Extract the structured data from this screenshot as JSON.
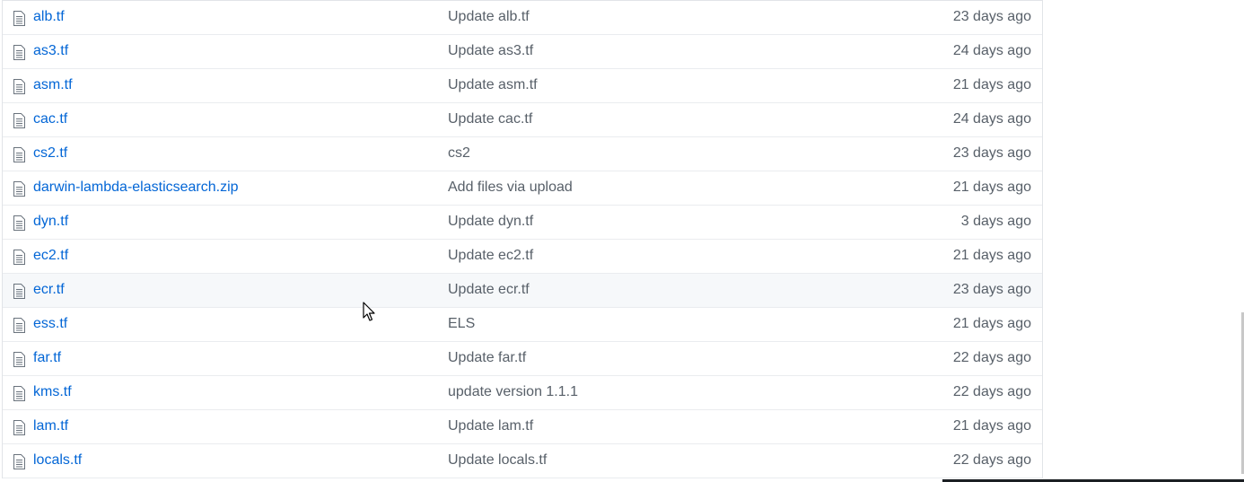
{
  "files": [
    {
      "name": "alb.tf",
      "message": "Update alb.tf",
      "age": "23 days ago"
    },
    {
      "name": "as3.tf",
      "message": "Update as3.tf",
      "age": "24 days ago"
    },
    {
      "name": "asm.tf",
      "message": "Update asm.tf",
      "age": "21 days ago"
    },
    {
      "name": "cac.tf",
      "message": "Update cac.tf",
      "age": "24 days ago"
    },
    {
      "name": "cs2.tf",
      "message": "cs2",
      "age": "23 days ago"
    },
    {
      "name": "darwin-lambda-elasticsearch.zip",
      "message": "Add files via upload",
      "age": "21 days ago"
    },
    {
      "name": "dyn.tf",
      "message": "Update dyn.tf",
      "age": "3 days ago"
    },
    {
      "name": "ec2.tf",
      "message": "Update ec2.tf",
      "age": "21 days ago"
    },
    {
      "name": "ecr.tf",
      "message": "Update ecr.tf",
      "age": "23 days ago"
    },
    {
      "name": "ess.tf",
      "message": "ELS",
      "age": "21 days ago"
    },
    {
      "name": "far.tf",
      "message": "Update far.tf",
      "age": "22 days ago"
    },
    {
      "name": "kms.tf",
      "message": "update version 1.1.1",
      "age": "22 days ago"
    },
    {
      "name": "lam.tf",
      "message": "Update lam.tf",
      "age": "21 days ago"
    },
    {
      "name": "locals.tf",
      "message": "Update locals.tf",
      "age": "22 days ago"
    }
  ],
  "icons": {
    "file": "file-text-icon",
    "cursor": "mouse-pointer-icon"
  },
  "colors": {
    "link": "#0366d6",
    "muted": "#586069",
    "border": "#eaecef",
    "hover_row": "#f6f8fa"
  }
}
